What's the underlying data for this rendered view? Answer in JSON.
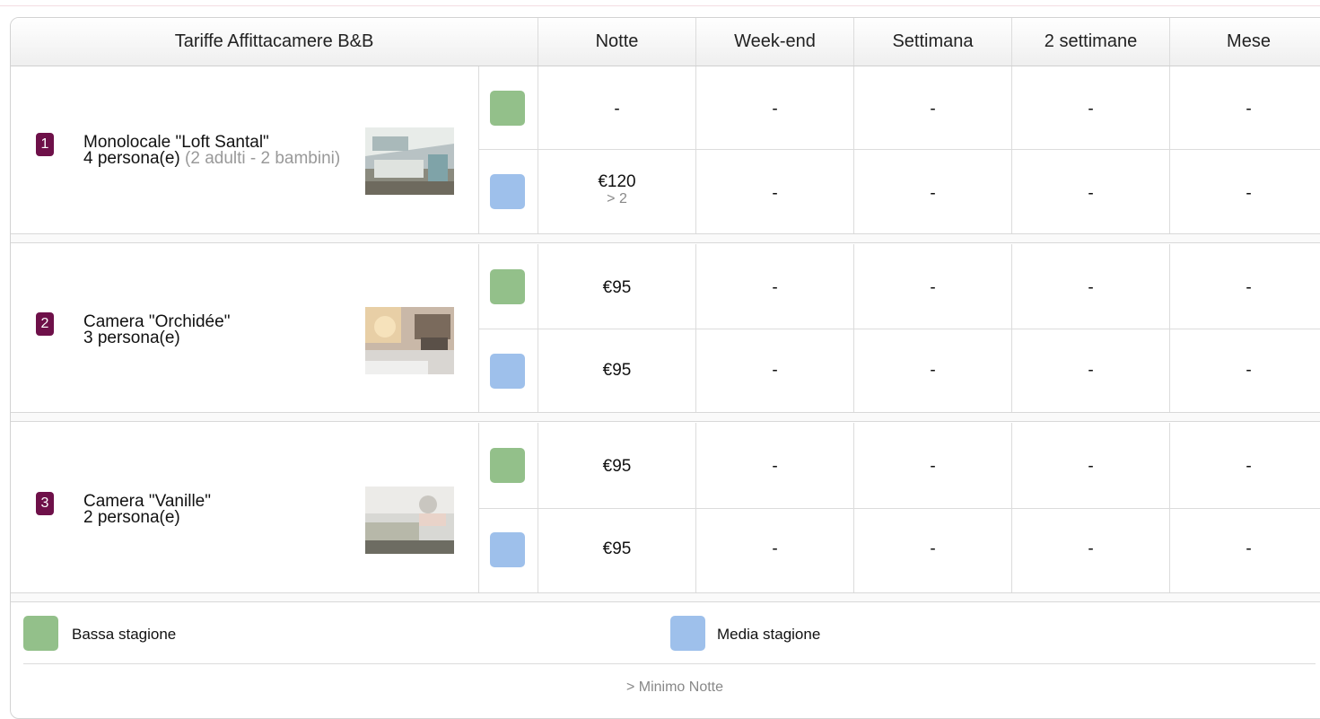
{
  "header": {
    "title": "Tariffe Affittacamere B&B",
    "columns": [
      "Notte",
      "Week-end",
      "Settimana",
      "2 settimane",
      "Mese"
    ]
  },
  "colors": {
    "low_season": "#93c08a",
    "mid_season": "#9ec0eb",
    "badge": "#6e1049"
  },
  "rooms": [
    {
      "number": "1",
      "name": "Monolocale \"Loft Santal\"",
      "capacity": "4 persona(e)",
      "detail": "(2 adulti - 2 bambini)",
      "rates": [
        {
          "season": "low",
          "values": [
            "-",
            "-",
            "-",
            "-",
            "-"
          ],
          "min": ""
        },
        {
          "season": "mid",
          "values": [
            "€120",
            "-",
            "-",
            "-",
            "-"
          ],
          "min": "> 2"
        }
      ]
    },
    {
      "number": "2",
      "name": "Camera \"Orchidée\"",
      "capacity": "3 persona(e)",
      "detail": "",
      "rates": [
        {
          "season": "low",
          "values": [
            "€95",
            "-",
            "-",
            "-",
            "-"
          ],
          "min": ""
        },
        {
          "season": "mid",
          "values": [
            "€95",
            "-",
            "-",
            "-",
            "-"
          ],
          "min": ""
        }
      ]
    },
    {
      "number": "3",
      "name": "Camera \"Vanille\"",
      "capacity": "2 persona(e)",
      "detail": "",
      "rates": [
        {
          "season": "low",
          "values": [
            "€95",
            "-",
            "-",
            "-",
            "-"
          ],
          "min": ""
        },
        {
          "season": "mid",
          "values": [
            "€95",
            "-",
            "-",
            "-",
            "-"
          ],
          "min": ""
        }
      ]
    }
  ],
  "legend": {
    "low_label": "Bassa stagione",
    "mid_label": "Media stagione",
    "note": "> Minimo Notte"
  }
}
